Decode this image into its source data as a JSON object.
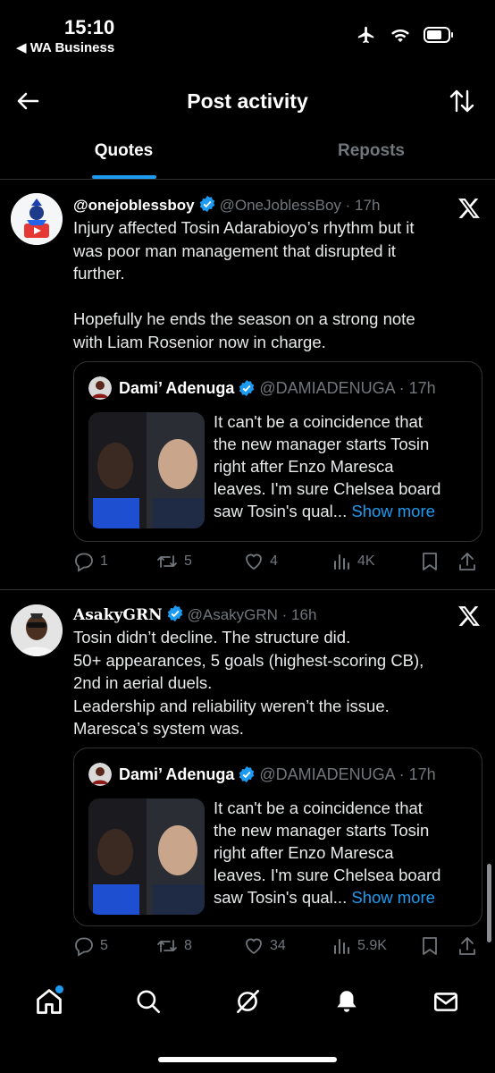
{
  "status_bar": {
    "time": "15:10",
    "back_app": "◀ WA Business",
    "icons": [
      "airplane-icon",
      "wifi-icon",
      "battery-icon"
    ]
  },
  "header": {
    "title": "Post activity",
    "back_icon": "arrow-left-icon",
    "sort_icon": "sort-arrows-icon"
  },
  "tabs": [
    {
      "label": "Quotes",
      "active": true
    },
    {
      "label": "Reposts",
      "active": false
    }
  ],
  "posts": [
    {
      "name": "@onejoblessboy",
      "handle": "@OneJoblessBoy · 17h",
      "body": [
        "Injury affected Tosin Adarabioyo’s rhythm but it",
        "was poor man management that disrupted it",
        "further.",
        "",
        "Hopefully he ends the season on a strong note",
        "with Liam Rosenior now in charge."
      ],
      "quote": {
        "name": "Dami’ Adenuga",
        "handle": "@DAMIADENUGA · 17h",
        "text": [
          "It can't be a coincidence that",
          "the new manager starts Tosin",
          "right after Enzo Maresca",
          "leaves. I'm sure Chelsea board"
        ],
        "last_line": "saw Tosin's qual...",
        "show_more": "Show more"
      },
      "stats": {
        "replies": "1",
        "reposts": "5",
        "likes": "4",
        "views": "4K"
      }
    },
    {
      "name": "AsakyGRN",
      "handle": "@AsakyGRN · 16h",
      "body": [
        "Tosin didn’t decline. The structure did.",
        "50+ appearances, 5 goals (highest-scoring CB),",
        "2nd in aerial duels.",
        "Leadership and reliability weren’t the issue.",
        "Maresca’s system was."
      ],
      "quote": {
        "name": "Dami’ Adenuga",
        "handle": "@DAMIADENUGA · 17h",
        "text": [
          "It can't be a coincidence that",
          "the new manager starts Tosin",
          "right after Enzo Maresca",
          "leaves. I'm sure Chelsea board"
        ],
        "last_line": "saw Tosin's qual...",
        "show_more": "Show more"
      },
      "stats": {
        "replies": "5",
        "reposts": "8",
        "likes": "34",
        "views": "5.9K"
      }
    }
  ],
  "nav": [
    "home-icon",
    "search-icon",
    "grok-icon",
    "notifications-icon",
    "messages-icon"
  ],
  "colors": {
    "accent": "#1d9bf0",
    "background": "#000000",
    "muted": "#71767b",
    "border": "#2f3336"
  }
}
